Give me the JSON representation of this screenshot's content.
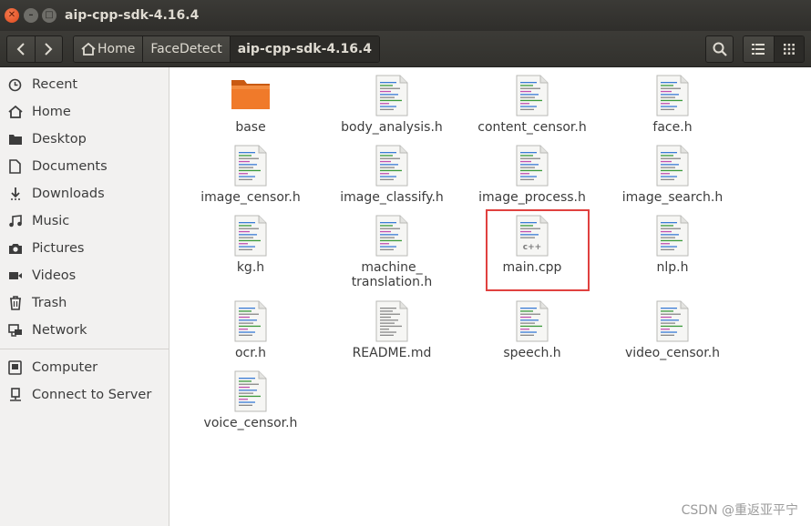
{
  "window": {
    "title": "aip-cpp-sdk-4.16.4"
  },
  "toolbar": {
    "breadcrumbs": [
      "Home",
      "FaceDetect",
      "aip-cpp-sdk-4.16.4"
    ]
  },
  "sidebar": {
    "places": [
      "Recent",
      "Home",
      "Desktop",
      "Documents",
      "Downloads",
      "Music",
      "Pictures",
      "Videos",
      "Trash",
      "Network"
    ],
    "devices": [
      "Computer",
      "Connect to Server"
    ]
  },
  "files": [
    {
      "name": "base",
      "type": "folder"
    },
    {
      "name": "body_analysis.h",
      "type": "header"
    },
    {
      "name": "content_censor.h",
      "type": "header"
    },
    {
      "name": "face.h",
      "type": "header"
    },
    {
      "name": "image_censor.h",
      "type": "header"
    },
    {
      "name": "image_classify.h",
      "type": "header"
    },
    {
      "name": "image_process.h",
      "type": "header"
    },
    {
      "name": "image_search.h",
      "type": "header"
    },
    {
      "name": "kg.h",
      "type": "header"
    },
    {
      "name": "machine_",
      "name2": "translation.h",
      "type": "header"
    },
    {
      "name": "main.cpp",
      "type": "cpp",
      "badge": "c++"
    },
    {
      "name": "nlp.h",
      "type": "header"
    },
    {
      "name": "ocr.h",
      "type": "header"
    },
    {
      "name": "README.md",
      "type": "text"
    },
    {
      "name": "speech.h",
      "type": "header"
    },
    {
      "name": "video_censor.h",
      "type": "header"
    },
    {
      "name": "voice_censor.h",
      "type": "header"
    }
  ],
  "watermark": "CSDN @重返亚平宁",
  "colors": {
    "accent_folder": "#f07a2a",
    "highlight_box": "#e0413f",
    "titlebar": "#35342f"
  }
}
